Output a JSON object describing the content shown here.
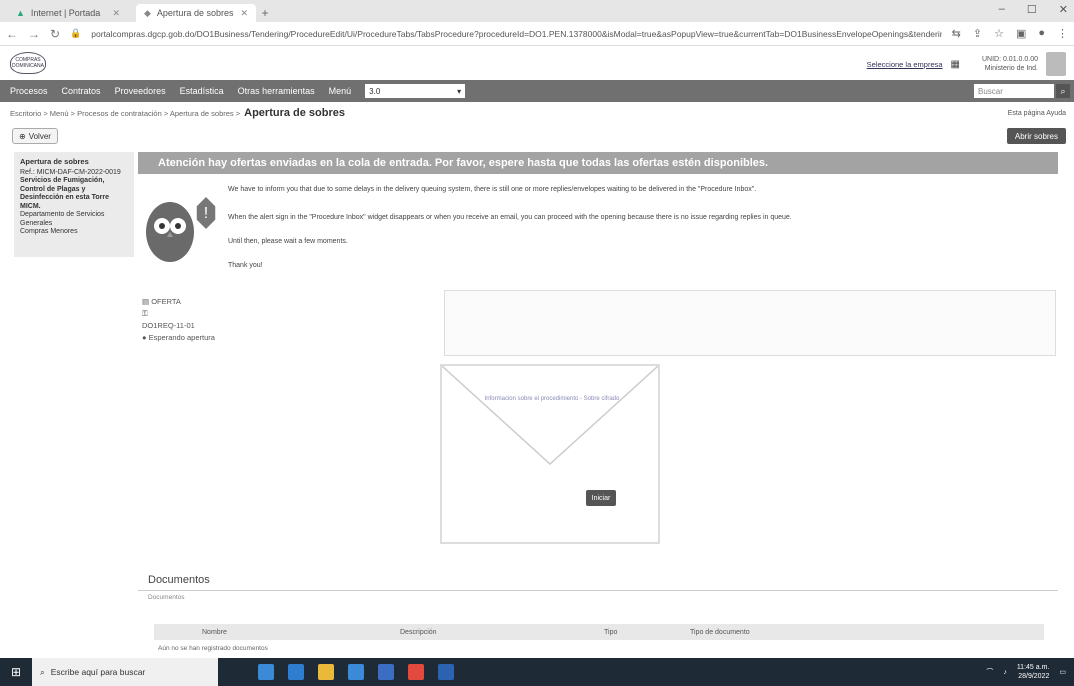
{
  "browser": {
    "tabs": [
      {
        "label": "Internet | Portada"
      },
      {
        "label": "Apertura de sobres"
      }
    ],
    "url": "portalcompras.dgcp.gob.do/DO1Business/Tendering/ProcedureEdit/Ui/ProcedureTabs/TabsProcedure?procedureId=DO1.PEN.1378000&isModal=true&asPopupView=true&currentTab=DO1BusinessEnvelopeOpenings&tenderingProcedure"
  },
  "header": {
    "logo_text": "COMPRAS DOMINICANA",
    "link": "Seleccione la empresa",
    "user_line1": "UNID: 0.01.0.0.00",
    "user_line2": "Ministerio de Ind."
  },
  "menu": {
    "items": [
      "Procesos",
      "Contratos",
      "Proveedores",
      "Estadística",
      "Otras herramientas",
      "Menú"
    ],
    "context_value": "3.0",
    "search_placeholder": "Buscar"
  },
  "breadcrumb": {
    "path": "Escritorio > Menú > Procesos de contratación > Apertura de sobres >",
    "current": "Apertura de sobres",
    "right": "Esta página  Ayuda"
  },
  "toolbar": {
    "view_label": "Volver",
    "open_label": "Abrir sobres"
  },
  "sidebar": {
    "title": "Apertura de sobres",
    "ref": "Ref.: MICM-DAF-CM-2022-0019",
    "desc": "Servicios de Fumigación, Control de Plagas y Desinfección en esta Torre MICM.",
    "dept": "Departamento de Servicios Generales",
    "type": "Compras Menores"
  },
  "alert": {
    "title": "Atención hay ofertas enviadas en la cola de entrada. Por favor, espere hasta que todas las ofertas estén disponibles.",
    "p1": "We have to inform you that due to some delays in the delivery queuing system, there is still one or more replies/envelopes waiting to be delivered in the \"Procedure Inbox\".",
    "p2": "When the alert sign in the \"Procedure Inbox\" widget disappears or when you receive an email, you can proceed with the opening because there is no issue regarding replies in queue.",
    "p3": "Until then, please wait a few moments.",
    "p4": "Thank you!"
  },
  "offer": {
    "label": "OFERTA",
    "code": "DO1REQ-11-01",
    "status": "Esperando apertura"
  },
  "envelope": {
    "text": "Informacion sobre el procedimiento - Sobre cifrado",
    "send": "Iniciar"
  },
  "documents": {
    "heading": "Documentos",
    "sub": "Documentos",
    "columns": [
      "Nombre",
      "Descripción",
      "Tipo",
      "Tipo de documento"
    ],
    "empty": "Aún no se han registrado documentos"
  },
  "taskbar": {
    "search": "Escribe aquí para buscar",
    "time": "11:45 a.m.",
    "date": "28/9/2022"
  }
}
